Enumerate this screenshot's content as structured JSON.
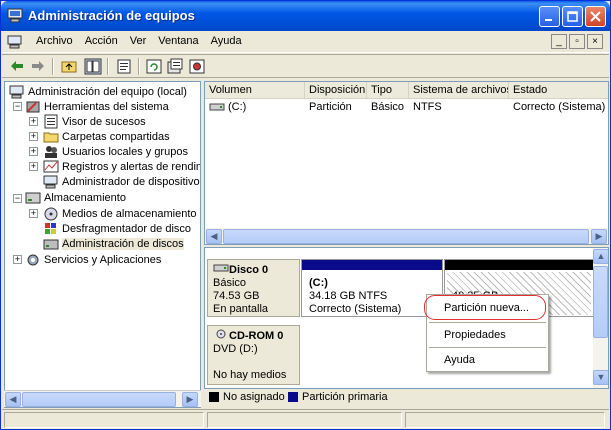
{
  "window": {
    "title": "Administración de equipos"
  },
  "menubar": {
    "items": [
      {
        "label": "Archivo"
      },
      {
        "label": "Acción"
      },
      {
        "label": "Ver"
      },
      {
        "label": "Ventana"
      },
      {
        "label": "Ayuda"
      }
    ]
  },
  "tree": {
    "root": "Administración del equipo (local)",
    "herramientas": "Herramientas del sistema",
    "visor": "Visor de sucesos",
    "carpetas": "Carpetas compartidas",
    "usuarios": "Usuarios locales y grupos",
    "registros": "Registros y alertas de rendim",
    "admin_disp": "Administrador de dispositivos",
    "almacenamiento": "Almacenamiento",
    "medios": "Medios de almacenamiento e",
    "desfrag": "Desfragmentador de disco",
    "admin_discos": "Administración de discos",
    "servicios": "Servicios y Aplicaciones"
  },
  "list": {
    "columns": [
      "Volumen",
      "Disposición",
      "Tipo",
      "Sistema de archivos",
      "Estado"
    ],
    "rows": [
      {
        "volumen": "(C:)",
        "disposicion": "Partición",
        "tipo": "Básico",
        "fs": "NTFS",
        "estado": "Correcto (Sistema)"
      }
    ]
  },
  "disks": {
    "disk0": {
      "name": "Disco 0",
      "type": "Básico",
      "size": "74.53 GB",
      "status": "En pantalla",
      "partition_c": {
        "label": "(C:)",
        "size": "34.18 GB NTFS",
        "status": "Correcto (Sistema)"
      },
      "partition_free": {
        "size": "40.35 GB"
      }
    },
    "cdrom0": {
      "name": "CD-ROM 0",
      "drive": "DVD (D:)",
      "status": "No hay medios"
    }
  },
  "legend": {
    "unallocated": "No asignado",
    "primary": "Partición primaria"
  },
  "context_menu": {
    "items": [
      "Partición nueva...",
      "Propiedades",
      "Ayuda"
    ]
  },
  "colors": {
    "title_blue": "#0058e6",
    "primary_partition": "#0a0a8a",
    "unallocated": "#000000",
    "highlight": "#e03030"
  }
}
